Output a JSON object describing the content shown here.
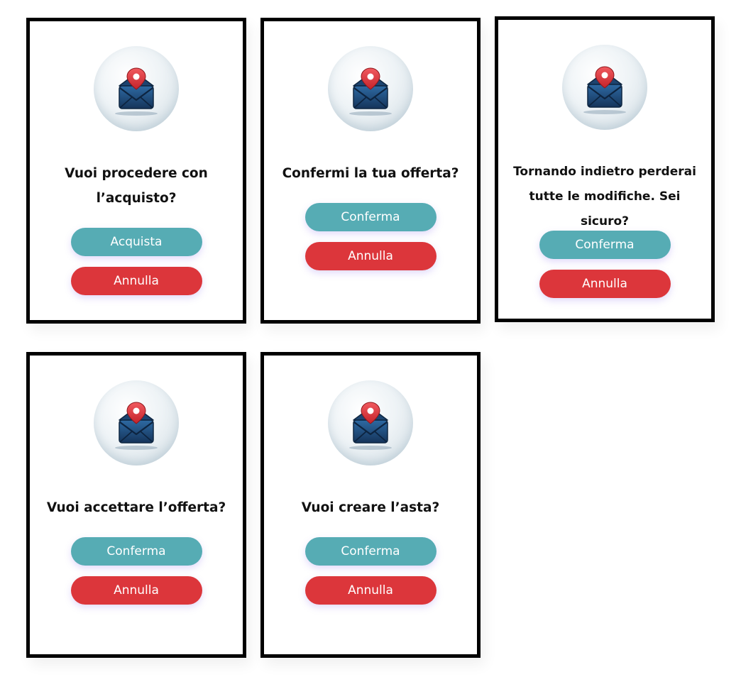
{
  "colors": {
    "confirm": "#56acb4",
    "cancel": "#dc363b",
    "border": "#000000",
    "envelope": "#1e4a78",
    "pin": "#e2343c"
  },
  "icon": "envelope-location-pin-icon",
  "dialogs": [
    {
      "question_lines": [
        "Vuoi procedere con",
        "l’acquisto?"
      ],
      "confirm_label": "Acquista",
      "cancel_label": "Annulla"
    },
    {
      "question_lines": [
        "Confermi la tua offerta?"
      ],
      "confirm_label": "Conferma",
      "cancel_label": "Annulla"
    },
    {
      "question_lines": [
        "Tornando indietro perderai",
        "tutte le modifiche. Sei sicuro?"
      ],
      "confirm_label": "Conferma",
      "cancel_label": "Annulla"
    },
    {
      "question_lines": [
        "Vuoi accettare l’offerta?"
      ],
      "confirm_label": "Conferma",
      "cancel_label": "Annulla"
    },
    {
      "question_lines": [
        "Vuoi creare l’asta?"
      ],
      "confirm_label": "Conferma",
      "cancel_label": "Annulla"
    }
  ]
}
